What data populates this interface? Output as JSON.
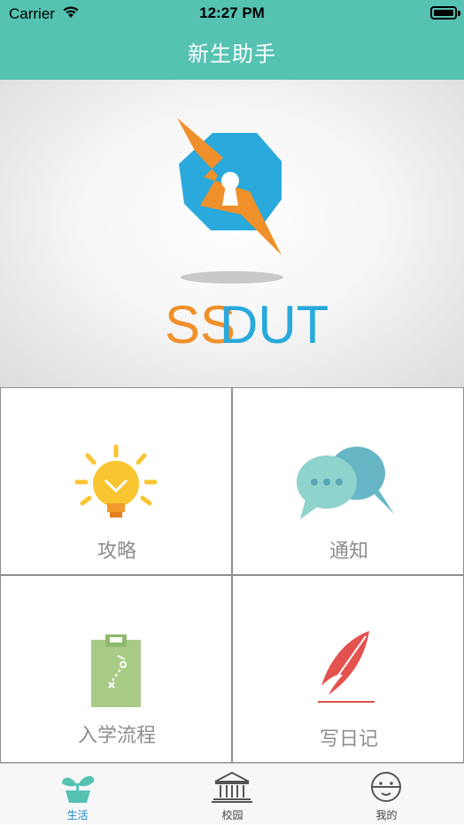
{
  "status_bar": {
    "carrier": "Carrier",
    "time": "12:27 PM"
  },
  "nav": {
    "title": "新生助手"
  },
  "banner": {
    "logo_text_orange": "SS",
    "logo_text_blue": "DUT"
  },
  "tiles": [
    {
      "label": "攻略",
      "icon": "lightbulb-icon"
    },
    {
      "label": "通知",
      "icon": "chat-bubbles-icon"
    },
    {
      "label": "入学流程",
      "icon": "clipboard-icon"
    },
    {
      "label": "写日记",
      "icon": "feather-icon"
    }
  ],
  "tabs": [
    {
      "label": "生活",
      "icon": "plant-icon",
      "active": true
    },
    {
      "label": "校园",
      "icon": "building-icon",
      "active": false
    },
    {
      "label": "我的",
      "icon": "face-icon",
      "active": false
    }
  ],
  "colors": {
    "accent": "#55c2b2",
    "logo_orange": "#f0902a",
    "logo_blue": "#29a9dc",
    "tab_active": "#1a8ad6",
    "tab_inactive": "#444444",
    "label_gray": "#8e8e8e"
  }
}
